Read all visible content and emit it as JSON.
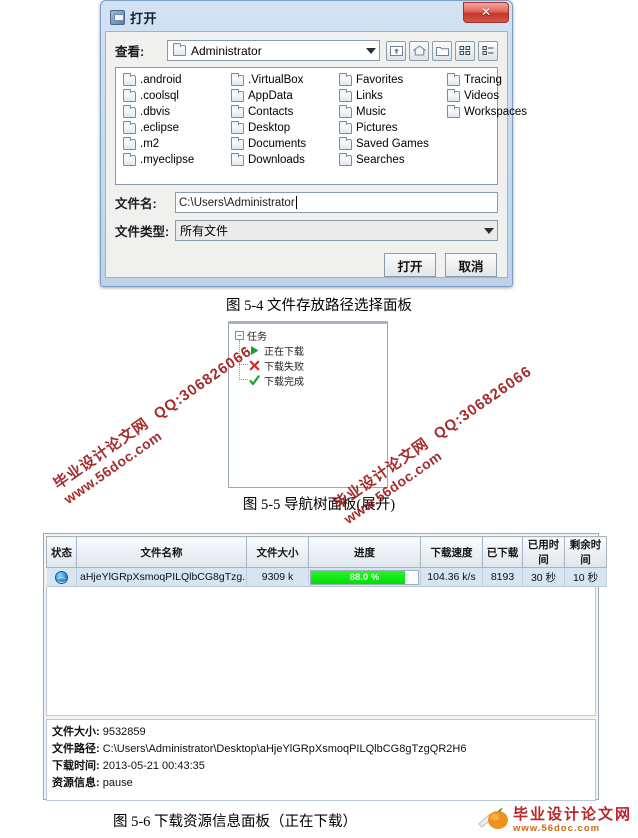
{
  "open_dialog": {
    "title": "打开",
    "close_label": "✕",
    "look_in_label": "查看:",
    "look_in_value": "Administrator",
    "toolbar_buttons": [
      {
        "name": "up-one-level-icon",
        "tip": "向上一层"
      },
      {
        "name": "home-icon",
        "tip": "主目录"
      },
      {
        "name": "new-folder-icon",
        "tip": "新建文件夹"
      },
      {
        "name": "list-view-icon",
        "tip": "列表"
      },
      {
        "name": "details-view-icon",
        "tip": "详细信息"
      }
    ],
    "files": [
      ".android",
      ".coolsql",
      ".dbvis",
      ".eclipse",
      ".m2",
      ".myeclipse",
      ".VirtualBox",
      "AppData",
      "Contacts",
      "Desktop",
      "Documents",
      "Downloads",
      "Favorites",
      "Links",
      "Music",
      "Pictures",
      "Saved Games",
      "Searches",
      "Tracing",
      "Videos",
      "Workspaces"
    ],
    "file_name_label": "文件名:",
    "file_name_value": "C:\\Users\\Administrator",
    "file_type_label": "文件类型:",
    "file_type_value": "所有文件",
    "open_button": "打开",
    "cancel_button": "取消"
  },
  "captions": {
    "fig_5_4": "图 5-4  文件存放路径选择面板",
    "fig_5_5": "图 5-5  导航树面板(展开)",
    "fig_5_6": "图 5-6  下载资源信息面板（正在下载）"
  },
  "nav_tree": {
    "root": "任务",
    "toggle": "−",
    "children": [
      {
        "label": "正在下载",
        "icon": "play-triangle-icon",
        "color": "#1f9e2e"
      },
      {
        "label": "下载失败",
        "icon": "cross-x-icon",
        "color": "#c8302b"
      },
      {
        "label": "下载完成",
        "icon": "check-mark-icon",
        "color": "#1f9e2e"
      }
    ]
  },
  "download_panel": {
    "columns": [
      "状态",
      "文件名称",
      "文件大小",
      "进度",
      "下载速度",
      "已下载",
      "已用时间",
      "剩余时间"
    ],
    "rows": [
      {
        "status_icon": "globe-icon",
        "name": "aHjeYlGRpXsmoqPILQlbCG8gTzg...",
        "size": "9309 k",
        "progress_text": "88.0 %",
        "progress_value": 88,
        "speed": "104.36 k/s",
        "downloaded": "8193",
        "elapsed": "30 秒",
        "remaining": "10 秒"
      }
    ],
    "info": [
      {
        "label": "文件大小:",
        "value": "9532859"
      },
      {
        "label": "文件路径:",
        "value": "C:\\Users\\Administrator\\Desktop\\aHjeYlGRpXsmoqPILQlbCG8gTzgQR2H6"
      },
      {
        "label": "下载时间:",
        "value": "2013-05-21 00:43:35"
      },
      {
        "label": "资源信息:",
        "value": "pause"
      }
    ]
  },
  "watermarks": [
    {
      "line1": "毕业设计论文网",
      "line2": "QQ:306826066",
      "line3": "www.56doc.com"
    },
    {
      "line1": "毕业设计论文网",
      "line2": "QQ:306826066",
      "line3": "www.56doc.com"
    }
  ],
  "site_logo": {
    "cn": "毕业设计论文网",
    "en": "www.56doc.com"
  }
}
